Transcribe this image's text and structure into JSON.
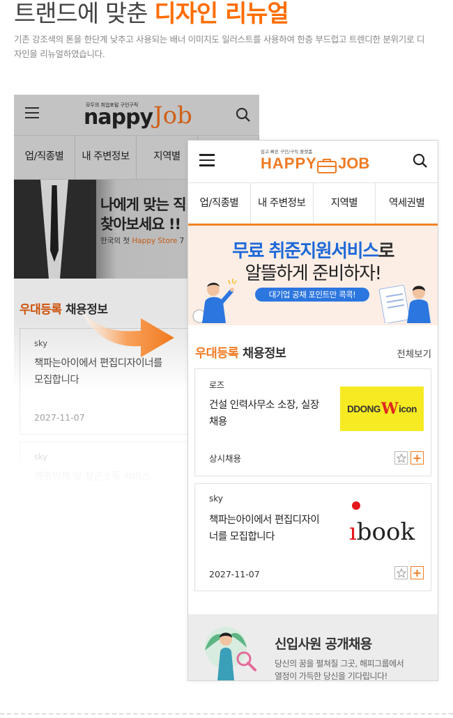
{
  "heading": {
    "prefix": "트랜드에 맞춘",
    "highlight": "디자인 리뉴얼",
    "description": "기존 강조색의 톤을 한단계 낮추고 사용되는 배너 이미지도 일러스트를 사용하여 한층 부드럽고 트렌디한 분위기로 디자인을 리뉴얼하였습니다."
  },
  "old_design": {
    "logo_small": "모두의 취업포털 구인구직",
    "logo_happy": "nappy",
    "logo_job": "Job",
    "nav": [
      "업/직종별",
      "내 주변정보",
      "지역별"
    ],
    "banner": {
      "line1": "나에게 맞는 직",
      "line2": "찾아보세요 !!",
      "line3_prefix": "한국의 첫 ",
      "line3_highlight": "Happy Store",
      "line3_suffix": " 7"
    },
    "section_title_accent": "우대등록",
    "section_title_rest": " 채용정보",
    "cards": [
      {
        "company": "sky",
        "title": "책파는아이에서 편집디자이너를 모집합니다",
        "date": "2027-11-07"
      },
      {
        "company": "sky",
        "title": "해충방제 및 살균소독 서비스",
        "date": ""
      }
    ]
  },
  "new_design": {
    "logo_small": "쉽고 빠른 구인/구직 플랫폼",
    "logo_happy": "HAPPY",
    "logo_job": "JOB",
    "nav": [
      "업/직종별",
      "내 주변정보",
      "지역별",
      "역세권별"
    ],
    "banner": {
      "line1_accent": "무료 취준지원서비스",
      "line1_rest": "로",
      "line2": "알뜰하게 준비하자!",
      "pill": "대기업 공채 포인트만 콕콕!"
    },
    "section_title_accent": "우대등록",
    "section_title_rest": " 채용정보",
    "more_link": "전체보기",
    "cards": [
      {
        "company": "로즈",
        "title": "건설 인력사무소 소장, 실장 채용",
        "footer": "상시채용",
        "logo_text_1": "DDONG",
        "logo_text_w": "W",
        "logo_text_2": "icon"
      },
      {
        "company": "sky",
        "title": "책파는아이에서 편집디자이너를 모집합니다",
        "footer": "2027-11-07",
        "logo_text": "book"
      }
    ],
    "bottom_banner": {
      "title": "신입사원 공개채용",
      "line1": "당신의 꿈을 펼쳐질 그곳, 해피그룹에서",
      "line2": "열정이 가득한 당신을 기다립니다!"
    }
  },
  "colors": {
    "accent": "#ef7b24",
    "blue": "#1e68d8",
    "old_accent": "#e35a0b"
  }
}
